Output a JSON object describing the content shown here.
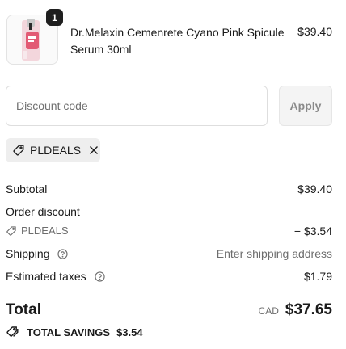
{
  "product": {
    "quantity": "1",
    "name": "Dr.Melaxin Cemenrete Cyano Pink Spicule Serum 30ml",
    "price": "$39.40"
  },
  "discount": {
    "placeholder": "Discount code",
    "apply_label": "Apply",
    "applied_code": "PLDEALS"
  },
  "summary": {
    "subtotal_label": "Subtotal",
    "subtotal_value": "$39.40",
    "order_discount_label": "Order discount",
    "order_discount_code": "PLDEALS",
    "order_discount_value": "− $3.54",
    "shipping_label": "Shipping",
    "shipping_value": "Enter shipping address",
    "taxes_label": "Estimated taxes",
    "taxes_value": "$1.79",
    "total_label": "Total",
    "currency": "CAD",
    "total_value": "$37.65",
    "savings_label": "TOTAL SAVINGS",
    "savings_value": "$3.54"
  },
  "icons": {
    "thumbnail": "serum-bottle-image",
    "tag": "tag-icon",
    "remove": "close-icon",
    "help": "help-circle-icon",
    "savings": "tags-icon"
  }
}
